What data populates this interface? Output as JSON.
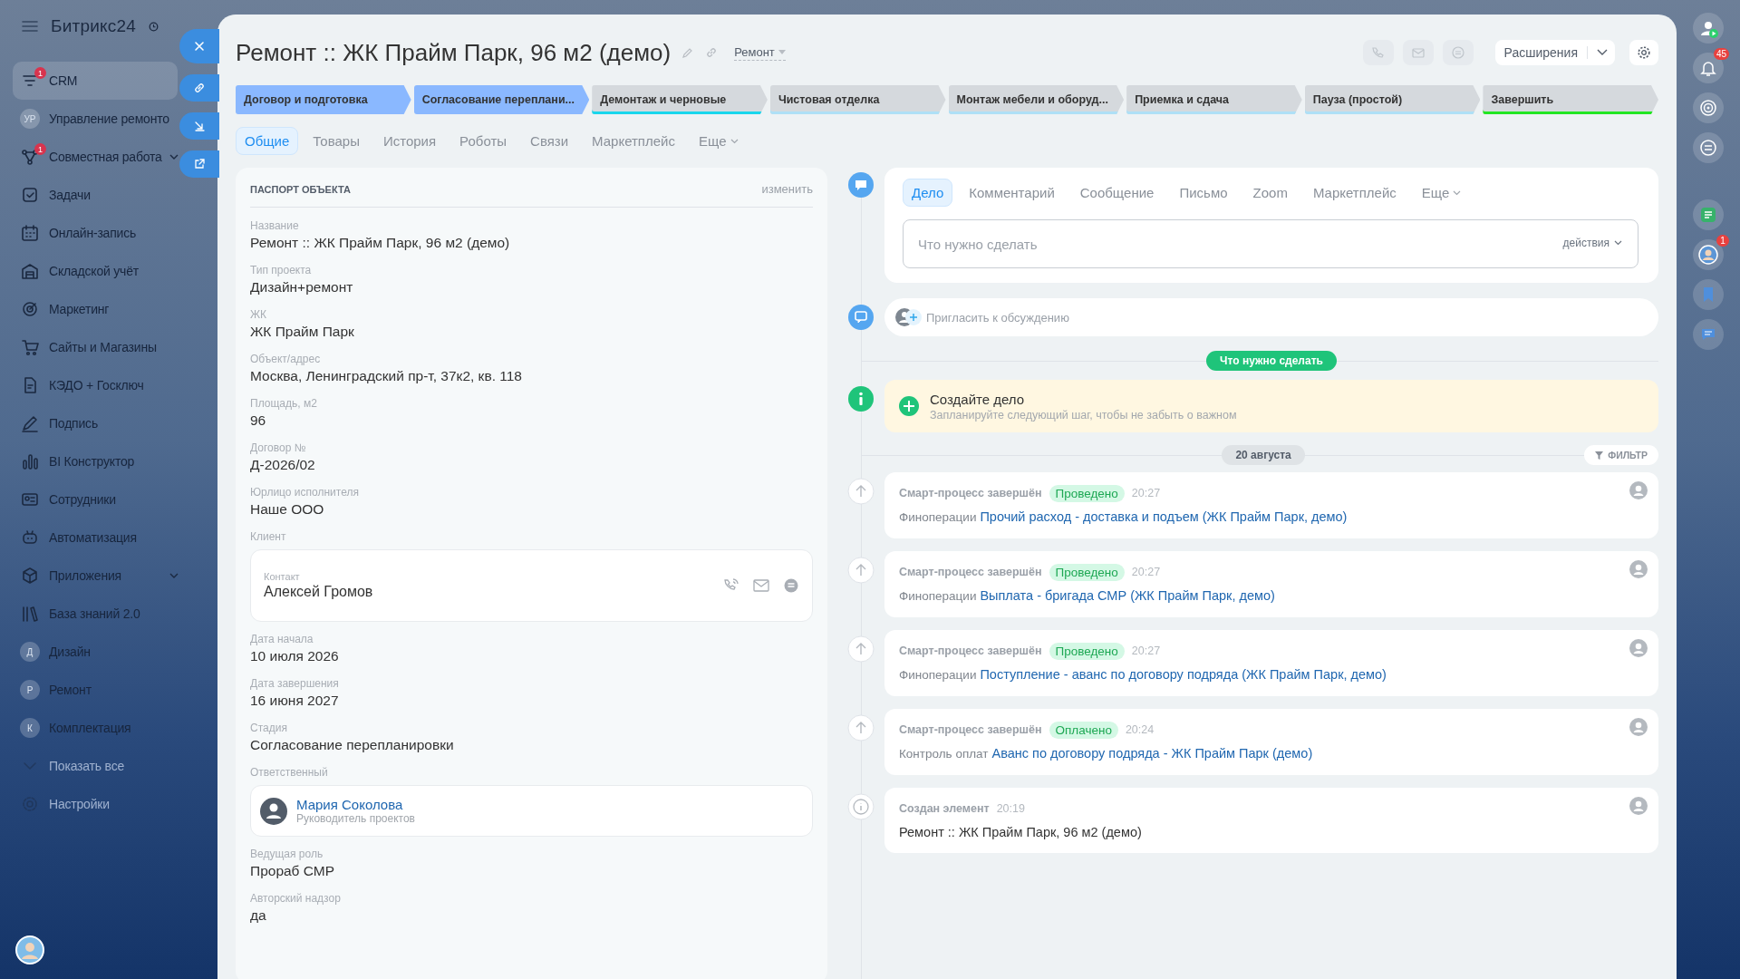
{
  "sidebar": {
    "logo": "Битрикс24",
    "items": [
      {
        "label": "CRM",
        "badge": "1",
        "selected": true,
        "dim": false,
        "menu": false
      },
      {
        "label": "Управление ремонто",
        "avatar": "УР",
        "selected": false,
        "dim": false,
        "menu": false
      },
      {
        "label": "Совместная работа",
        "badge": "1",
        "selected": false,
        "dim": false,
        "menu": true
      },
      {
        "label": "Задачи",
        "selected": false,
        "dim": false,
        "menu": false
      },
      {
        "label": "Онлайн-запись",
        "selected": false,
        "dim": false,
        "menu": false
      },
      {
        "label": "Складской учёт",
        "selected": false,
        "dim": false,
        "menu": false
      },
      {
        "label": "Маркетинг",
        "selected": false,
        "dim": false,
        "menu": false
      },
      {
        "label": "Сайты и Магазины",
        "selected": false,
        "dim": false,
        "menu": false
      },
      {
        "label": "КЭДО + Госключ",
        "selected": false,
        "dim": false,
        "menu": false
      },
      {
        "label": "Подпись",
        "selected": false,
        "dim": false,
        "menu": false
      },
      {
        "label": "BI Конструктор",
        "selected": false,
        "dim": false,
        "menu": false
      },
      {
        "label": "Сотрудники",
        "selected": false,
        "dim": false,
        "menu": false
      },
      {
        "label": "Автоматизация",
        "selected": false,
        "dim": false,
        "menu": false
      },
      {
        "label": "Приложения",
        "selected": false,
        "dim": false,
        "menu": true
      },
      {
        "label": "База знаний 2.0",
        "selected": false,
        "dim": false,
        "menu": false
      },
      {
        "label": "Дизайн",
        "avatar": "Д",
        "selected": false,
        "dim": false,
        "menu": false
      },
      {
        "label": "Ремонт",
        "avatar": "Р",
        "selected": false,
        "dim": false,
        "menu": false
      },
      {
        "label": "Комплектация",
        "avatar": "К",
        "selected": false,
        "dim": false,
        "menu": false
      },
      {
        "label": "Показать все",
        "selected": false,
        "dim": true,
        "menu": false
      },
      {
        "label": "Настройки",
        "selected": false,
        "dim": true,
        "menu": false
      }
    ]
  },
  "header": {
    "title": "Ремонт :: ЖК Прайм Парк, 96 м2 (демо)",
    "category": "Ремонт",
    "extensions": "Расширения"
  },
  "stages": [
    {
      "label": "Договор и подготовка",
      "passed": true,
      "color": "#8ab8ff"
    },
    {
      "label": "Согласование переплани...",
      "passed": true,
      "color": "#8ab8ff"
    },
    {
      "label": "Демонтаж и черновые",
      "passed": false,
      "color": "#19d6ec"
    },
    {
      "label": "Чистовая отделка",
      "passed": false,
      "color": "#aee0f6"
    },
    {
      "label": "Монтаж мебели и оборуд...",
      "passed": false,
      "color": "#aee0f6"
    },
    {
      "label": "Приемка и сдача",
      "passed": false,
      "color": "#aee0f6"
    },
    {
      "label": "Пауза (простой)",
      "passed": false,
      "color": "#aee0f6"
    },
    {
      "label": "Завершить",
      "passed": false,
      "color": "#22e622"
    }
  ],
  "tabs": [
    {
      "label": "Общие",
      "selected": true,
      "menu": false
    },
    {
      "label": "Товары",
      "selected": false,
      "menu": false
    },
    {
      "label": "История",
      "selected": false,
      "menu": false
    },
    {
      "label": "Роботы",
      "selected": false,
      "menu": false
    },
    {
      "label": "Связи",
      "selected": false,
      "menu": false
    },
    {
      "label": "Маркетплейс",
      "selected": false,
      "menu": false
    },
    {
      "label": "Еще",
      "selected": false,
      "menu": true
    }
  ],
  "passport": {
    "title": "ПАСПОРТ ОБЪЕКТА",
    "edit": "изменить",
    "fields": [
      {
        "kind": "text",
        "label": "Название",
        "value": "Ремонт :: ЖК Прайм Парк, 96 м2 (демо)"
      },
      {
        "kind": "text",
        "label": "Тип проекта",
        "value": "Дизайн+ремонт"
      },
      {
        "kind": "text",
        "label": "ЖК",
        "value": "ЖК Прайм Парк"
      },
      {
        "kind": "text",
        "label": "Объект/адрес",
        "value": "Москва, Ленинградский пр-т, 37к2, кв. 118"
      },
      {
        "kind": "text",
        "label": "Площадь, м2",
        "value": "96"
      },
      {
        "kind": "text",
        "label": "Договор №",
        "value": "Д-2026/02"
      },
      {
        "kind": "text",
        "label": "Юрлицо исполнителя",
        "value": "Наше ООО"
      },
      {
        "kind": "contact",
        "label": "Клиент",
        "type": "Контакт",
        "name": "Алексей Громов"
      },
      {
        "kind": "text",
        "label": "Дата начала",
        "value": "10 июля 2026"
      },
      {
        "kind": "text",
        "label": "Дата завершения",
        "value": "16 июня 2027"
      },
      {
        "kind": "text",
        "label": "Стадия",
        "value": "Согласование перепланировки"
      },
      {
        "kind": "user",
        "label": "Ответственный",
        "name": "Мария Соколова",
        "role": "Руководитель проектов"
      },
      {
        "kind": "text",
        "label": "Ведущая роль",
        "value": "Прораб СМР"
      },
      {
        "kind": "text",
        "label": "Авторский надзор",
        "value": "да"
      }
    ]
  },
  "composer": {
    "tabs": [
      {
        "label": "Дело",
        "selected": true,
        "menu": false
      },
      {
        "label": "Комментарий",
        "selected": false,
        "menu": false
      },
      {
        "label": "Сообщение",
        "selected": false,
        "menu": false
      },
      {
        "label": "Письмо",
        "selected": false,
        "menu": false
      },
      {
        "label": "Zoom",
        "selected": false,
        "menu": false
      },
      {
        "label": "Маркетплейс",
        "selected": false,
        "menu": false
      },
      {
        "label": "Еще",
        "selected": false,
        "menu": true
      }
    ],
    "placeholder": "Что нужно сделать",
    "actions": "действия"
  },
  "invite": {
    "placeholder": "Пригласить к обсуждению"
  },
  "todo_label": "Что нужно сделать",
  "todo_card": {
    "title": "Создайте дело",
    "hint": "Запланируйте следующий шаг, чтобы не забыть о важном"
  },
  "date": "20 августа",
  "filter": "ФИЛЬТР",
  "events": [
    {
      "kind": "step",
      "title": "Смарт-процесс завершён",
      "status": "Проведено",
      "time": "20:27",
      "category": "Финоперации",
      "link": "Прочий расход - доставка и подъем (ЖК Прайм Парк, демо)"
    },
    {
      "kind": "step",
      "title": "Смарт-процесс завершён",
      "status": "Проведено",
      "time": "20:27",
      "category": "Финоперации",
      "link": "Выплата - бригада СМР (ЖК Прайм Парк, демо)"
    },
    {
      "kind": "step",
      "title": "Смарт-процесс завершён",
      "status": "Проведено",
      "time": "20:27",
      "category": "Финоперации",
      "link": "Поступление - аванс по договору подряда (ЖК Прайм Парк, демо)"
    },
    {
      "kind": "step",
      "title": "Смарт-процесс завершён",
      "status": "Оплачено",
      "time": "20:24",
      "category": "Контроль оплат",
      "link": "Аванс по договору подряда - ЖК Прайм Парк (демо)"
    },
    {
      "kind": "created",
      "title": "Создан элемент",
      "time": "20:19",
      "text": "Ремонт :: ЖК Прайм Парк, 96 м2 (демо)"
    }
  ],
  "right_bar": {
    "notifications": "45",
    "chat_badge": "1"
  }
}
